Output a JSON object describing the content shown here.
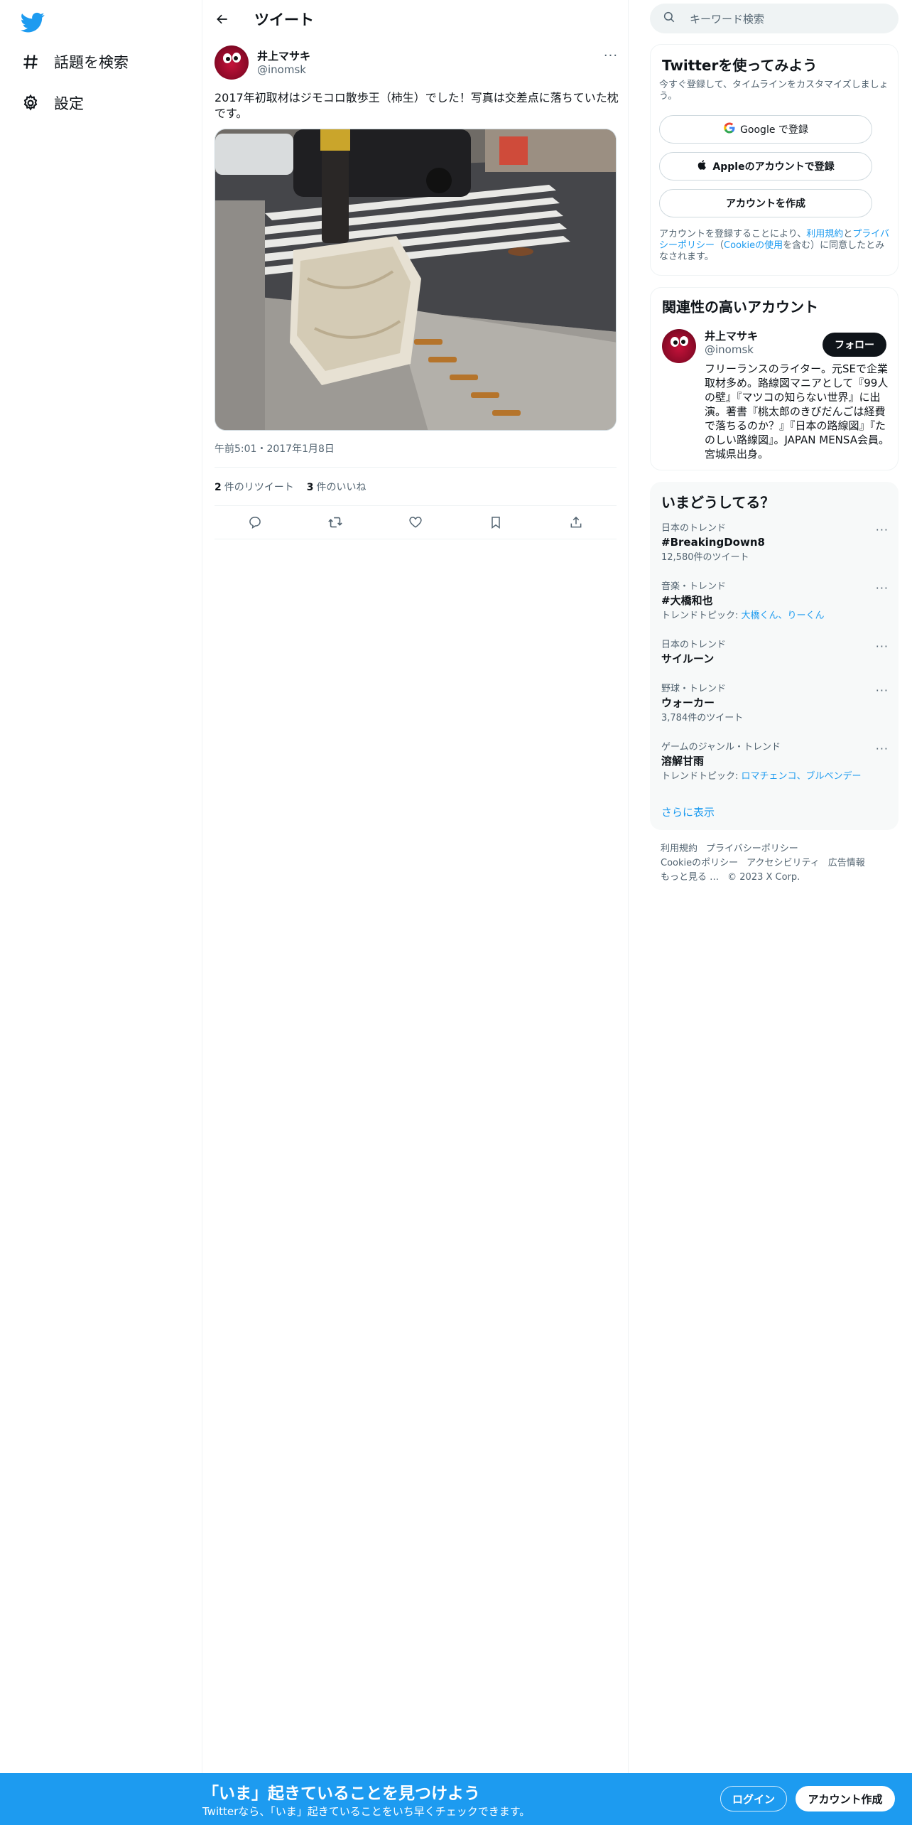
{
  "colors": {
    "accent": "#1d9bf0",
    "text": "#0f1419",
    "muted": "#536471",
    "panel": "#f7f9f9"
  },
  "nav": {
    "logo": "twitter-bird-icon",
    "items": [
      {
        "icon": "hashtag-icon",
        "label": "話題を検索"
      },
      {
        "icon": "gear-icon",
        "label": "設定"
      }
    ]
  },
  "header": {
    "title": "ツイート"
  },
  "tweet": {
    "author": "井上マサキ",
    "handle": "@inomsk",
    "text": "2017年初取材はジモコロ散歩王（柿生）でした！写真は交差点に落ちていた枕です。",
    "timestamp": "午前5:01・2017年1月8日",
    "retweets": "2",
    "retweets_label": "件のリツイート",
    "likes": "3",
    "likes_label": "件のいいね"
  },
  "search": {
    "placeholder": "キーワード検索"
  },
  "signup": {
    "title": "Twitterを使ってみよう",
    "subtitle": "今すぐ登録して、タイムラインをカスタマイズしましょう。",
    "google": "Google で登録",
    "apple": "Appleのアカウントで登録",
    "create": "アカウントを作成",
    "legal_1": "アカウントを登録することにより、",
    "legal_terms": "利用規約",
    "legal_2": "と",
    "legal_privacy": "プライバシーポリシー",
    "legal_3": "（",
    "legal_cookie": "Cookieの使用",
    "legal_4": "を含む）に同意したとみなされます。"
  },
  "related": {
    "title": "関連性の高いアカウント",
    "name": "井上マサキ",
    "handle": "@inomsk",
    "follow": "フォロー",
    "bio": "フリーランスのライター。元SEで企業取材多め。路線図マニアとして『99人の壁』『マツコの知らない世界』に出演。著書『桃太郎のきびだんごは経費で落ちるのか？』『日本の路線図』『たのしい路線図』。JAPAN MENSA会員。宮城県出身。"
  },
  "trends": {
    "title": "いまどうしてる？",
    "items": [
      {
        "meta": "日本のトレンド",
        "name": "#BreakingDown8",
        "sub": "12,580件のツイート",
        "sub_prefix": "",
        "links": ""
      },
      {
        "meta": "音楽・トレンド",
        "name": "#大橋和也",
        "sub": "",
        "sub_prefix": "トレンドトピック: ",
        "links": "大橋くん、りーくん"
      },
      {
        "meta": "日本のトレンド",
        "name": "サイルーン",
        "sub": "",
        "sub_prefix": "",
        "links": ""
      },
      {
        "meta": "野球・トレンド",
        "name": "ウォーカー",
        "sub": "3,784件のツイート",
        "sub_prefix": "",
        "links": ""
      },
      {
        "meta": "ゲームのジャンル・トレンド",
        "name": "溶解甘雨",
        "sub": "",
        "sub_prefix": "トレンドトピック: ",
        "links": "ロマチェンコ、ブルベンデー"
      }
    ],
    "show_more": "さらに表示"
  },
  "footer": {
    "terms": "利用規約",
    "privacy": "プライバシーポリシー",
    "cookie": "Cookieのポリシー",
    "accessibility": "アクセシビリティ",
    "ads": "広告情報",
    "more": "もっと見る …",
    "copyright": "© 2023 X Corp."
  },
  "banner": {
    "title": "「いま」起きていることを見つけよう",
    "subtitle": "Twitterなら、「いま」起きていることをいち早くチェックできます。",
    "login": "ログイン",
    "signup": "アカウント作成"
  }
}
